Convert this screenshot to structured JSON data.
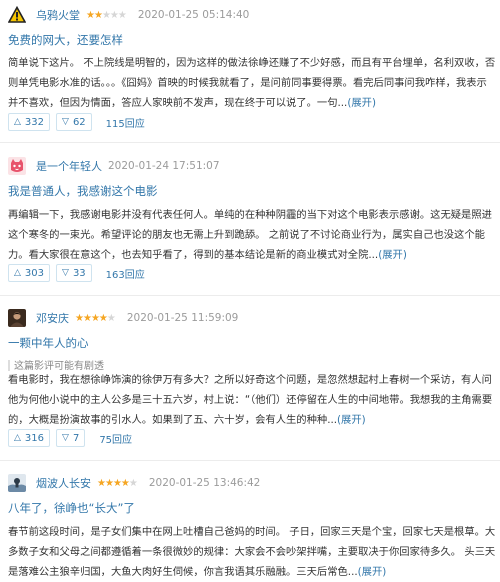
{
  "reviews": [
    {
      "user": "乌鸦火堂",
      "rating_stars": 2,
      "time": "2020-01-25 05:14:40",
      "title": "免费的网大，还要怎样",
      "body": "简单说下这片。 不上院线是明智的，因为这样的做法徐峥还赚了不少好感，而且有平台埋单，名利双收，否则单凭电影水准的话。。。《囧妈》首映的时候我就看了，是问前同事要得票。看完后同事问我咋样，我表示并不喜欢，但因为情面，答应人家映前不发声，现在终于可以说了。一句...",
      "more": "(展开)",
      "up": "332",
      "down": "62",
      "replies": "115回应"
    },
    {
      "user": "是一个年轻人",
      "rating_stars": 0,
      "time": "2020-01-24 17:51:07",
      "title": "我是普通人，我感谢这个电影",
      "body": "再编辑一下，我感谢电影并没有代表任何人。单纯的在种种阴霾的当下对这个电影表示感谢。这无疑是照进这个寒冬的一束光。希望评论的朋友也无需上升到跪舔。 之前说了不讨论商业行为，属实自己也没这个能力。看大家很在意这个，也去知乎看了，得到的基本结论是新的商业模式对全院...",
      "more": "(展开)",
      "up": "303",
      "down": "33",
      "replies": "163回应"
    },
    {
      "user": "邓安庆",
      "rating_stars": 4,
      "time": "2020-01-25 11:59:09",
      "title": "一颗中年人的心",
      "spoiler": "这篇影评可能有剧透",
      "body": "看电影时，我在想徐峥饰演的徐伊万有多大？之所以好奇这个问题，是忽然想起村上春树一个采访，有人问他为何他小说中的主人公多是三十五六岁，村上说：“（他们）还停留在人生的中间地带。我想我的主角需要的，大概是扮演故事的引水人。如果到了五、六十岁，会有人生的种种...",
      "more": "(展开)",
      "up": "316",
      "down": "7",
      "replies": "75回应"
    },
    {
      "user": "烟波人长安",
      "rating_stars": 4,
      "time": "2020-01-25 13:46:42",
      "title": "八年了，徐峥也“长大”了",
      "body": "春节前这段时间，是子女们集中在网上吐槽自己爸妈的时间。 子日，回家三天是个宝，回家七天是根草。大多数子女和父母之间都遵循着一条很微妙的规律：大家会不会吵架拌嘴，主要取决于你回家待多久。 头三天是落难公主狼辛归国，大鱼大肉好生伺候，你言我语其乐融融。三天后常色...",
      "more": "(展开)"
    }
  ],
  "colors": {
    "link": "#3377aa",
    "star_on": "#f5a623",
    "star_off": "#d6d6d6",
    "time": "#9b9b9b"
  },
  "icons": [
    "warning-avatar-icon",
    "cat-avatar-icon",
    "portrait-avatar-icon",
    "photo-avatar-icon",
    "star-icon",
    "thumb-up-icon",
    "thumb-down-icon"
  ]
}
